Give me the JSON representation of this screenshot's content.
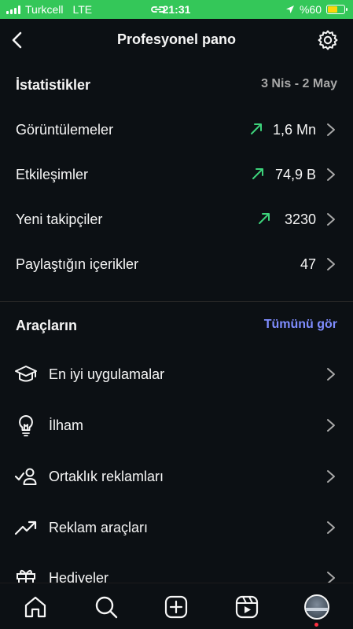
{
  "status_bar": {
    "carrier": "Turkcell",
    "network": "LTE",
    "time": "21:31",
    "battery": "%60",
    "battery_level": 0.6
  },
  "header": {
    "title": "Profesyonel pano"
  },
  "stats": {
    "title": "İstatistikler",
    "date_range": "3 Nis - 2 May",
    "rows": [
      {
        "label": "Görüntülemeler",
        "value": "1,6 Mn",
        "trend": "up"
      },
      {
        "label": "Etkileşimler",
        "value": "74,9 B",
        "trend": "up"
      },
      {
        "label": "Yeni takipçiler",
        "value": "3230",
        "trend": "up"
      },
      {
        "label": "Paylaştığın içerikler",
        "value": "47",
        "trend": "none"
      }
    ]
  },
  "tools": {
    "title": "Araçların",
    "see_all": "Tümünü gör",
    "items": [
      {
        "label": "En iyi uygulamalar",
        "icon": "graduation-cap-icon"
      },
      {
        "label": "İlham",
        "icon": "lightbulb-icon"
      },
      {
        "label": "Ortaklık reklamları",
        "icon": "partnership-icon"
      },
      {
        "label": "Reklam araçları",
        "icon": "trending-up-icon"
      },
      {
        "label": "Hediyeler",
        "icon": "gift-icon"
      }
    ]
  },
  "colors": {
    "background": "#0c1014",
    "trend_up": "#3dd37b",
    "link": "#7f8dff",
    "status_bar": "#34c759"
  }
}
